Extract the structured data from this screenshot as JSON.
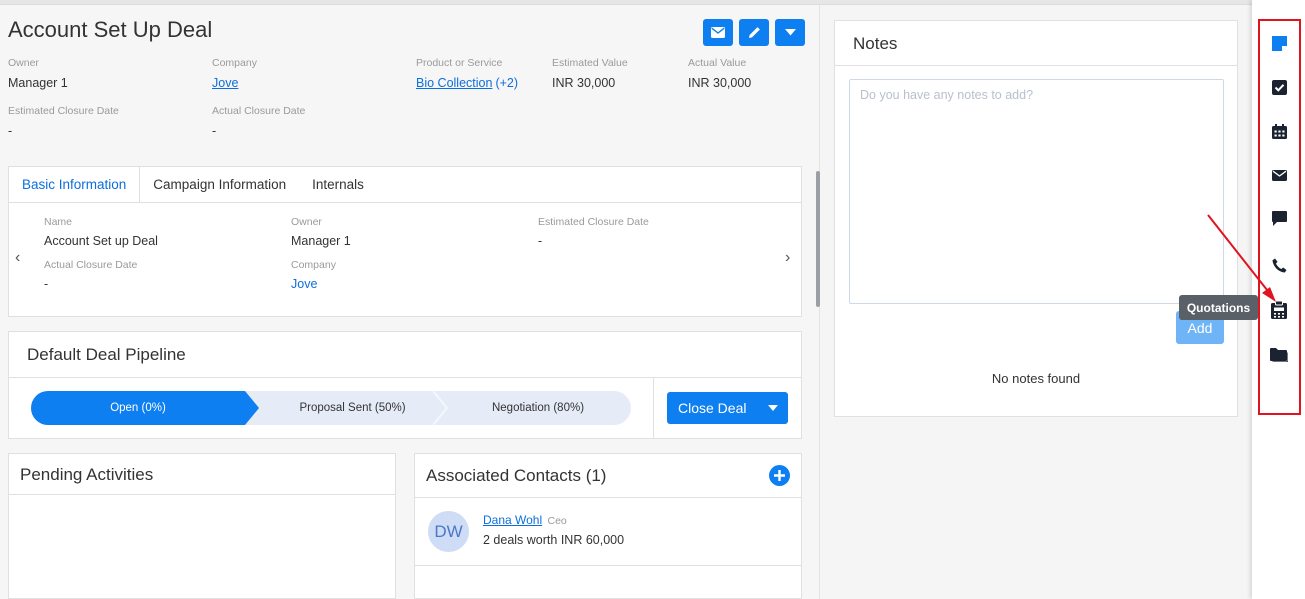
{
  "deal": {
    "title": "Account Set Up Deal",
    "fields": {
      "owner_label": "Owner",
      "owner": "Manager 1",
      "company_label": "Company",
      "company": "Jove",
      "product_label": "Product or Service",
      "product": "Bio Collection",
      "product_more": "(+2)",
      "est_value_label": "Estimated Value",
      "est_value": "INR 30,000",
      "actual_value_label": "Actual Value",
      "actual_value": "INR 30,000",
      "est_closure_label": "Estimated Closure Date",
      "est_closure": "-",
      "actual_closure_label": "Actual Closure Date",
      "actual_closure": "-"
    }
  },
  "tabs": [
    "Basic Information",
    "Campaign Information",
    "Internals"
  ],
  "basic_info": {
    "name_label": "Name",
    "name": "Account Set up Deal",
    "owner_label": "Owner",
    "owner": "Manager 1",
    "est_closure_label": "Estimated Closure Date",
    "est_closure": "-",
    "actual_closure_label": "Actual Closure Date",
    "actual_closure": "-",
    "company_label": "Company",
    "company": "Jove"
  },
  "pipeline": {
    "title": "Default Deal Pipeline",
    "stages": [
      "Open (0%)",
      "Proposal Sent (50%)",
      "Negotiation (80%)"
    ],
    "close_label": "Close Deal"
  },
  "pending": {
    "title": "Pending Activities"
  },
  "contacts": {
    "title": "Associated Contacts (1)",
    "items": [
      {
        "initials": "DW",
        "name": "Dana Wohl",
        "role": "Ceo",
        "summary": "2 deals worth INR 60,000"
      }
    ]
  },
  "notes": {
    "title": "Notes",
    "placeholder": "Do you have any notes to add?",
    "add_label": "Add",
    "empty": "No notes found"
  },
  "sidebar": {
    "tooltip": "Quotations",
    "icons": [
      "notes-icon",
      "tasks-icon",
      "calendar-icon",
      "email-icon",
      "chat-icon",
      "phone-icon",
      "quotations-icon",
      "folder-icon"
    ]
  },
  "colors": {
    "primary": "#0d7ff0",
    "highlight": "#e0141e"
  }
}
